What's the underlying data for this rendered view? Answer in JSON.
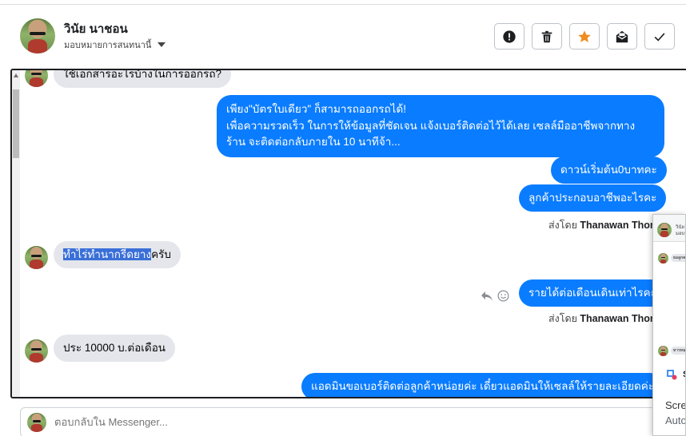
{
  "header": {
    "name": "วินัย นาชอน",
    "assign_label": "มอบหมายการสนทนานี้"
  },
  "actions": [
    {
      "name": "mark-spam-button",
      "icon": "alert-circle-icon"
    },
    {
      "name": "delete-button",
      "icon": "trash-icon"
    },
    {
      "name": "star-button",
      "icon": "star-icon"
    },
    {
      "name": "mark-unread-button",
      "icon": "envelope-icon"
    },
    {
      "name": "done-button",
      "icon": "check-icon"
    }
  ],
  "messages": {
    "m0": "ใช้เอกสารอะไรบ้างในการออกรถ?",
    "m1_line1": "เพียง\"บัตรใบเดียว\" ก็สามารถออกรถได้!",
    "m1_line2": "เพื่อความรวดเร็ว ในการให้ข้อมูลที่ชัดเจน แจ้งเบอร์ติดต่อไว้ได้เลย เซลล์มืออาชีพจากทาง",
    "m1_line3": "ร้าน จะติดต่อกลับภายใน 10 นาทีจ้า...",
    "m2": "ดาวน์เริ่มต้น0บาทคะ",
    "m3": "ลูกค้าประกอบอาชีพอะไรคะ",
    "sent_by_1_prefix": "ส่งโดย",
    "sent_by_1_name": "Thanawan Thon",
    "m4_highlight": "ทำไร่ทำนากรีดยาง",
    "m4_rest": "ครับ",
    "m5": "รายได้ต่อเดือนเดินเท่าไรคะ",
    "sent_by_2_prefix": "ส่งโดย",
    "sent_by_2_name": "Thanawan Thon",
    "m6": "ประ 10000 บ.ต่อเดือน",
    "m7": "แอดมินขอเบอร์ติดต่อลูกค้าหน่อยค่ะ เดี๋ยวแอดมินให้เซลล์ให้รายละเอียดค่ะ"
  },
  "composer": {
    "placeholder": "ตอบกลับใน Messenger..."
  },
  "overlay": {
    "row1_text1": "วินัย",
    "row1_text2": "มอบห",
    "row2_text": "ธอลูกค",
    "row3_text": "ทารทม",
    "icon_s": "S",
    "text1": "Scre",
    "text2": "Auto"
  },
  "colors": {
    "outgoing_bubble": "#0a7cff",
    "incoming_bubble": "#e4e6eb",
    "star": "#f08c1e"
  }
}
